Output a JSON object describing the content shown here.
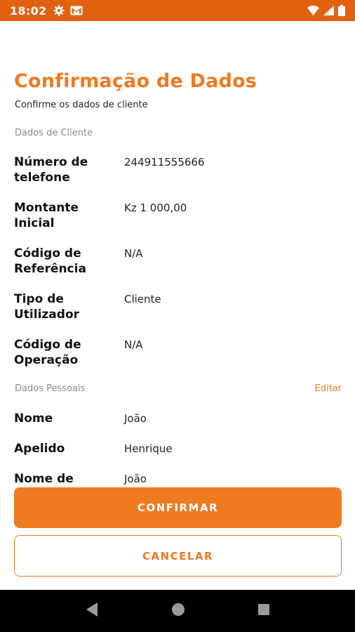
{
  "status_bar": {
    "time": "18:02",
    "left_icons": [
      "gear-icon",
      "gmail-icon"
    ],
    "right_icons": [
      "wifi-icon",
      "signal-icon",
      "battery-icon"
    ]
  },
  "header": {
    "title": "Confirmação de Dados",
    "subtitle": "Confirme os dados de cliente"
  },
  "client_section": {
    "label": "Dados de Cliente",
    "rows": [
      {
        "label": "Número de telefone",
        "value": "244911555666"
      },
      {
        "label": "Montante Inicial",
        "value": "Kz 1 000,00"
      },
      {
        "label": "Código de Referência",
        "value": "N/A"
      },
      {
        "label": "Tipo de Utilizador",
        "value": "Cliente"
      },
      {
        "label": "Código de Operação",
        "value": "N/A"
      }
    ]
  },
  "personal_section": {
    "label": "Dados Pessoais",
    "edit_label": "Editar",
    "rows": [
      {
        "label": "Nome",
        "value": "João"
      },
      {
        "label": "Apelido",
        "value": "Henrique"
      },
      {
        "label": "Nome de",
        "value": "João"
      }
    ]
  },
  "actions": {
    "confirm_label": "CONFIRMAR",
    "cancel_label": "CANCELAR"
  },
  "colors": {
    "accent": "#f07a22",
    "status_bar": "#e2610f"
  }
}
